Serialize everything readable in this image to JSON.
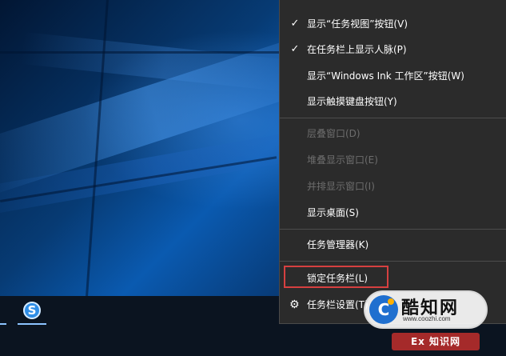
{
  "menu": {
    "items": [
      {
        "label": "显示“任务视图”按钮(V)",
        "checked": true,
        "disabled": false
      },
      {
        "label": "在任务栏上显示人脉(P)",
        "checked": true,
        "disabled": false
      },
      {
        "label": "显示“Windows Ink 工作区”按钮(W)",
        "checked": false,
        "disabled": false
      },
      {
        "label": "显示触摸键盘按钮(Y)",
        "checked": false,
        "disabled": false
      },
      {
        "label": "层叠窗口(D)",
        "checked": false,
        "disabled": true
      },
      {
        "label": "堆叠显示窗口(E)",
        "checked": false,
        "disabled": true
      },
      {
        "label": "并排显示窗口(I)",
        "checked": false,
        "disabled": true
      },
      {
        "label": "显示桌面(S)",
        "checked": false,
        "disabled": false
      },
      {
        "label": "任务管理器(K)",
        "checked": false,
        "disabled": false
      },
      {
        "label": "锁定任务栏(L)",
        "checked": false,
        "disabled": false,
        "highlighted": true
      },
      {
        "label": "任务栏设置(T)",
        "checked": false,
        "disabled": false,
        "icon": "gear-icon"
      }
    ],
    "check_glyph": "✓",
    "highlight_color": "#d64040"
  },
  "taskbar": {
    "app_icon": "sogou-icon",
    "app_glyph": "S"
  },
  "watermark": {
    "logo_glyph": "C",
    "title": "酷知网",
    "url": "www.coozhi.com",
    "strip": "Ex 知识网"
  }
}
